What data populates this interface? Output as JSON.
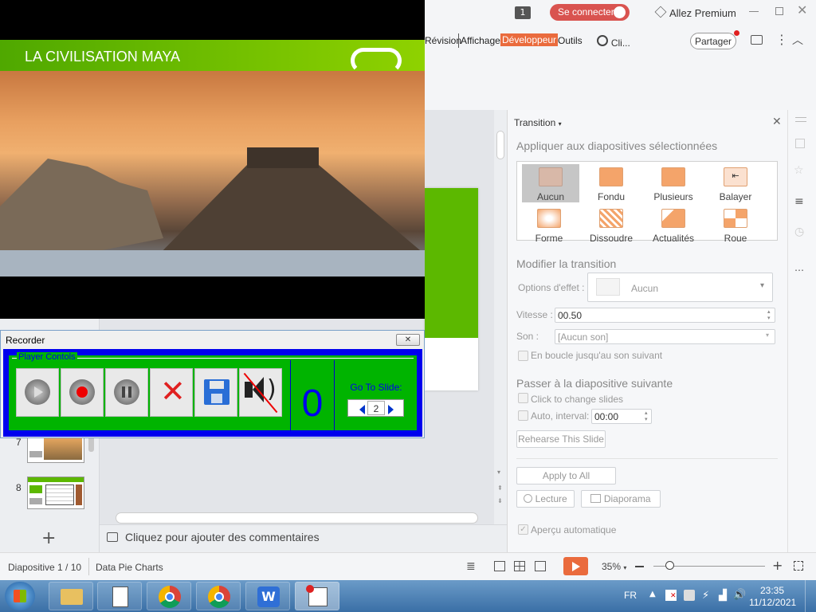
{
  "titlebar": {
    "badge": "1",
    "login_label": "Se connecter",
    "premium_label": "Allez Premium",
    "min_icon": "minimize-icon",
    "max_icon": "restore-icon",
    "close_icon": "close-icon"
  },
  "ribbon": {
    "tabs": [
      "Révision",
      "Affichage",
      "Développeur",
      "Outils"
    ],
    "search_label": "Cli...",
    "share_label": "Partager"
  },
  "video": {
    "title": "LA CIVILISATION MAYA"
  },
  "recorder": {
    "window_title": "Recorder",
    "group_label": "Player Contols",
    "counter": "0",
    "goto_label": "Go To Slide:",
    "slide_value": "2"
  },
  "thumbnails": [
    {
      "number": "7"
    },
    {
      "number": "8"
    }
  ],
  "notes": {
    "placeholder": "Cliquez pour ajouter des commentaires"
  },
  "transition_panel": {
    "title": "Transition",
    "apply_heading": "Appliquer aux diapositives sélectionnées",
    "effects": [
      "Aucun",
      "Fondu",
      "Plusieurs",
      "Balayer",
      "Forme",
      "Dissoudre",
      "Actualités",
      "Roue"
    ],
    "selected_effect": "Aucun",
    "modify_heading": "Modifier la transition",
    "options_label": "Options d'effet :",
    "options_value": "Aucun",
    "speed_label": "Vitesse :",
    "speed_value": "00.50",
    "sound_label": "Son :",
    "sound_value": "[Aucun son]",
    "loop_label": "En boucle jusqu'au son suivant",
    "next_heading": "Passer à la diapositive suivante",
    "click_label": "Click to change slides",
    "auto_label": "Auto, interval:",
    "auto_value": "00:00",
    "rehearse_label": "Rehearse This Slide",
    "apply_all_label": "Apply to All",
    "play_label": "Lecture",
    "slideshow_label": "Diaporama",
    "preview_label": "Aperçu automatique"
  },
  "statusbar": {
    "slide_info": "Diapositive 1 / 10",
    "theme": "Data Pie Charts",
    "zoom": "35%"
  },
  "taskbar": {
    "lang": "FR",
    "time": "23:35",
    "date": "11/12/2021"
  },
  "colors": {
    "accent_orange": "#ea6b3d",
    "login_red": "#d9534f",
    "slide_green": "#5cb800",
    "recorder_blue": "#0000ee",
    "recorder_green": "#00b400"
  }
}
